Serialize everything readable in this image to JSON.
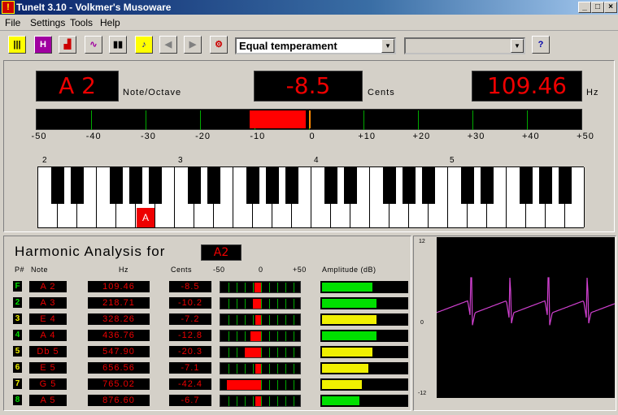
{
  "window": {
    "title": "TuneIt 3.10  -  Volkmer's Musoware",
    "minimize": "_",
    "maximize": "□",
    "close": "×"
  },
  "menu": [
    "File",
    "Settings",
    "Tools",
    "Help"
  ],
  "toolbar": {
    "buttons": [
      {
        "name": "keyboard-view-icon",
        "glyph": "|||"
      },
      {
        "name": "harmonics-view-icon",
        "glyph": "H"
      },
      {
        "name": "spectrum-view-icon",
        "glyph": "▟"
      },
      {
        "name": "waveform-view-icon",
        "glyph": "∿"
      },
      {
        "name": "pause-icon",
        "glyph": "▮▮"
      },
      {
        "name": "tuning-fork-icon",
        "glyph": "♪"
      },
      {
        "name": "prev-icon",
        "glyph": "◀"
      },
      {
        "name": "next-icon",
        "glyph": "▶"
      },
      {
        "name": "settings-icon",
        "glyph": "⚙"
      }
    ],
    "temperament": "Equal temperament",
    "second_combo": "",
    "help_glyph": "?"
  },
  "tuner": {
    "note": "A 2",
    "note_label": "Note/Octave",
    "cents": "-8.5",
    "cents_label": "Cents",
    "freq": "109.46",
    "freq_label": "Hz",
    "cents_value": -8.5,
    "scale": [
      "-50",
      "-40",
      "-30",
      "-20",
      "-10",
      "0",
      "+10",
      "+20",
      "+30",
      "+40",
      "+50"
    ],
    "octaves": [
      "2",
      "3",
      "4",
      "5"
    ],
    "marker": "A"
  },
  "harmonic": {
    "title": "Harmonic Analysis for",
    "note": "A2",
    "headers": {
      "p": "P#",
      "note": "Note",
      "hz": "Hz",
      "cents": "Cents",
      "m50": "-50",
      "zero": "0",
      "p50": "+50",
      "amp": "Amplitude (dB)"
    },
    "rows": [
      {
        "p": "F",
        "note": "A 2",
        "hz": "109.46",
        "cents": "-8.5",
        "cv": -8.5,
        "amp": 0.6,
        "color": "#00e000"
      },
      {
        "p": "2",
        "note": "A 3",
        "hz": "218.71",
        "cents": "-10.2",
        "cv": -10.2,
        "amp": 0.64,
        "color": "#00e000"
      },
      {
        "p": "3",
        "note": "E 4",
        "hz": "328.26",
        "cents": "-7.2",
        "cv": -7.2,
        "amp": 0.64,
        "color": "#f0f000"
      },
      {
        "p": "4",
        "note": "A 4",
        "hz": "436.76",
        "cents": "-12.8",
        "cv": -12.8,
        "amp": 0.64,
        "color": "#00e000"
      },
      {
        "p": "5",
        "note": "Db 5",
        "hz": "547.90",
        "cents": "-20.3",
        "cv": -20.3,
        "amp": 0.6,
        "color": "#f0f000"
      },
      {
        "p": "6",
        "note": "E 5",
        "hz": "656.56",
        "cents": "-7.1",
        "cv": -7.1,
        "amp": 0.55,
        "color": "#f0f000"
      },
      {
        "p": "7",
        "note": "G 5",
        "hz": "765.02",
        "cents": "-42.4",
        "cv": -42.4,
        "amp": 0.47,
        "color": "#f0f000"
      },
      {
        "p": "8",
        "note": "A 5",
        "hz": "876.60",
        "cents": "-6.7",
        "cv": -6.7,
        "amp": 0.44,
        "color": "#00e000"
      }
    ]
  },
  "waveform": {
    "ymax": "12",
    "ymid": "0",
    "ymin": "-12",
    "color": "#d040d0"
  }
}
